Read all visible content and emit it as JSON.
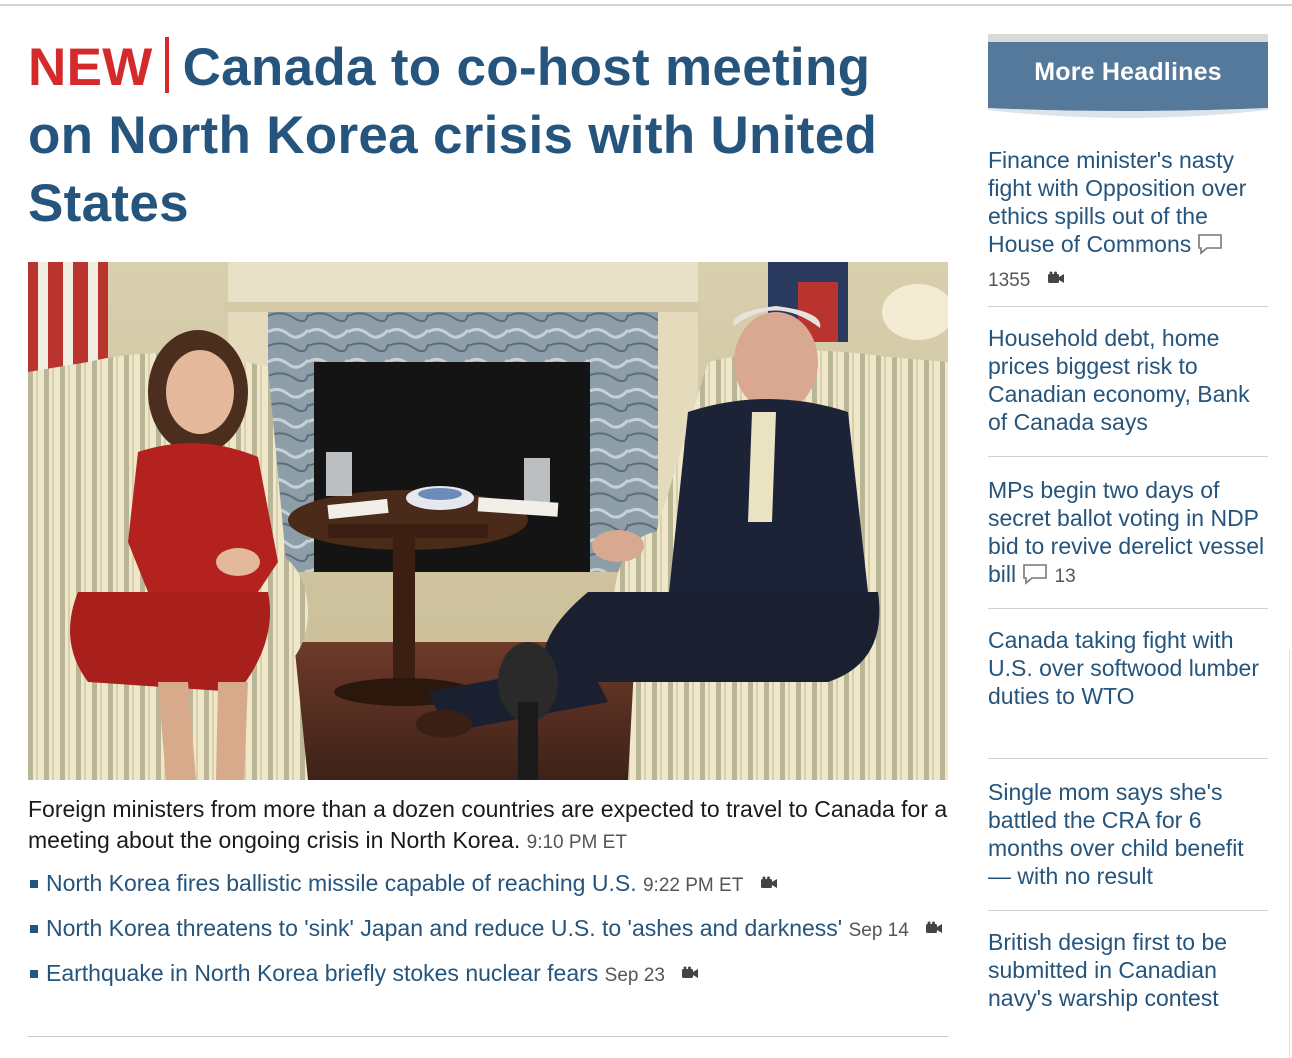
{
  "main_story": {
    "new_label": "NEW",
    "headline": "Canada to co-host meeting on North Korea crisis with United States",
    "photo_alt": "Chrystia Freeland and Rex Tillerson seated in armchairs before a fireplace",
    "summary": "Foreign ministers from more than a dozen countries are expected to travel to Canada for a meeting about the ongoing crisis in North Korea.",
    "timestamp": "9:10 PM ET",
    "related": [
      {
        "title": "North Korea fires ballistic missile capable of reaching U.S.",
        "date": "9:22 PM ET",
        "icon": "video-camera-icon"
      },
      {
        "title": "North Korea threatens to 'sink' Japan and reduce U.S. to 'ashes and darkness'",
        "date": "Sep 14",
        "icon": "video-camera-icon"
      },
      {
        "title": "Earthquake in North Korea briefly stokes nuclear fears",
        "date": "Sep 23",
        "icon": "video-camera-icon"
      }
    ]
  },
  "sidebar": {
    "title": "More Headlines",
    "items": [
      {
        "title": "Finance minister's nasty fight with Opposition over ethics spills out of the House of Commons",
        "comment_icon": "comment-icon",
        "count": "1355",
        "count_icon": "video-camera-icon"
      },
      {
        "title": "Household debt, home prices biggest risk to Canadian economy, Bank of Canada says"
      },
      {
        "title": "MPs begin two days of secret ballot voting in NDP bid to revive derelict vessel bill",
        "comment_icon": "comment-icon",
        "count": "13"
      },
      {
        "title": "Canada taking fight with U.S. over softwood lumber duties to WTO"
      },
      {
        "title": "Single mom says she's battled the CRA for 6 months over child benefit — with no result"
      },
      {
        "title": "British design first to be submitted in Canadian navy's warship contest"
      }
    ]
  },
  "colors": {
    "headline_blue": "#25547c",
    "new_red": "#d42a2b",
    "sidebar_header_bg": "#55799a"
  }
}
